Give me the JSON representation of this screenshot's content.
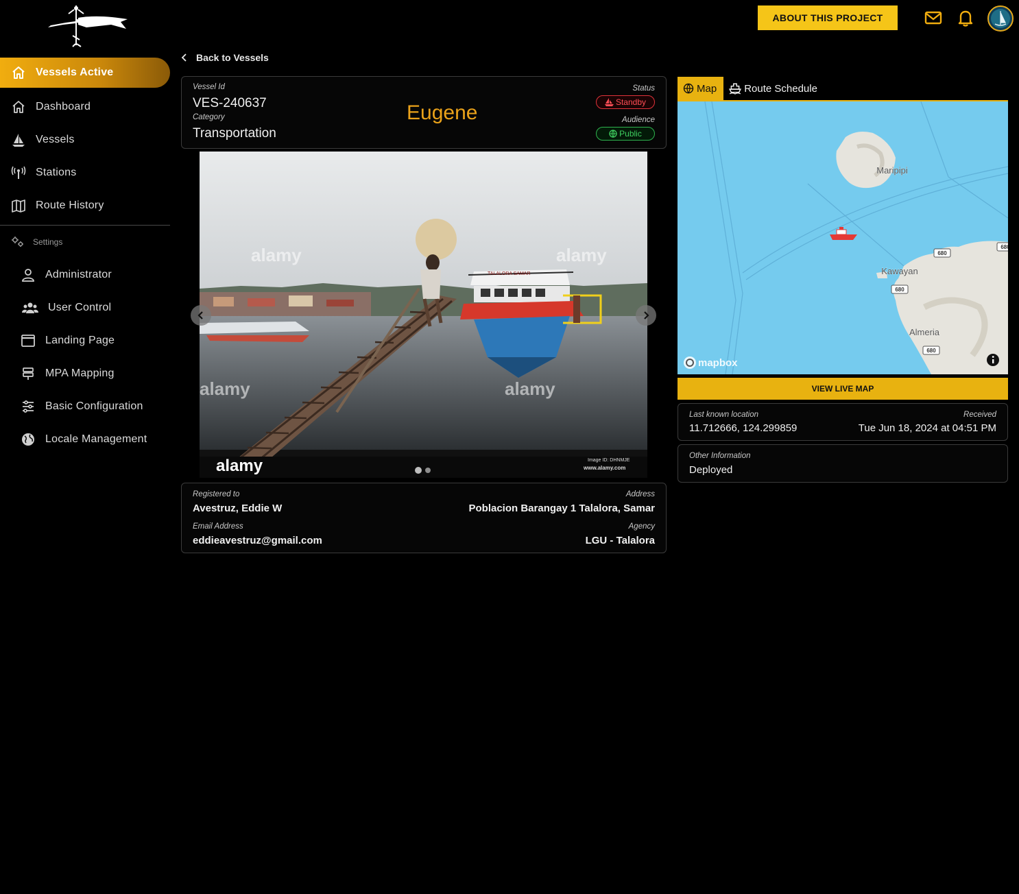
{
  "header": {
    "about_label": "ABOUT THIS PROJECT",
    "icons": [
      "mail-icon",
      "bell-icon",
      "avatar"
    ],
    "accent_color": "#f5c518"
  },
  "sidebar": {
    "items": [
      {
        "label": "Vessels Active",
        "icon": "home-icon",
        "active": true
      },
      {
        "label": "Dashboard",
        "icon": "home-icon"
      },
      {
        "label": "Vessels",
        "icon": "sailboat-icon"
      },
      {
        "label": "Stations",
        "icon": "antenna-icon"
      },
      {
        "label": "Route History",
        "icon": "map-icon"
      }
    ],
    "settings_label": "Settings",
    "settings_items": [
      {
        "label": "Administrator",
        "icon": "user-icon"
      },
      {
        "label": "User Control",
        "icon": "users-icon"
      },
      {
        "label": "Landing Page",
        "icon": "window-icon"
      },
      {
        "label": "MPA Mapping",
        "icon": "signpost-icon"
      },
      {
        "label": "Basic Configuration",
        "icon": "sliders-icon"
      },
      {
        "label": "Locale Management",
        "icon": "globe-icon"
      }
    ]
  },
  "back_label": "Back to Vessels",
  "vessel": {
    "id_label": "Vessel Id",
    "id": "VES-240637",
    "category_label": "Category",
    "category": "Transportation",
    "name": "Eugene",
    "status_label": "Status",
    "status": "Standby",
    "audience_label": "Audience",
    "audience": "Public"
  },
  "photo": {
    "watermark": "alamy",
    "image_id": "Image ID: DHNMJE",
    "site": "www.alamy.com",
    "boat_sign": "TALALORA SAMAR",
    "slides": 2,
    "current_slide": 1
  },
  "owner": {
    "registered_label": "Registered to",
    "registered": "Avestruz, Eddie W",
    "address_label": "Address",
    "address": "Poblacion Barangay 1 Talalora, Samar",
    "email_label": "Email Address",
    "email": "eddieavestruz@gmail.com",
    "agency_label": "Agency",
    "agency": "LGU - Talalora"
  },
  "tabs": [
    {
      "label": "Map",
      "icon": "globe-icon",
      "active": true
    },
    {
      "label": "Route Schedule",
      "icon": "ship-icon"
    }
  ],
  "map": {
    "places": [
      "Maripipi",
      "Kawayan",
      "Almeria"
    ],
    "road_shield": "680",
    "attribution": "mapbox"
  },
  "view_live_label": "VIEW LIVE MAP",
  "location": {
    "label": "Last known location",
    "value": "11.712666, 124.299859",
    "received_label": "Received",
    "received": "Tue Jun 18, 2024 at 04:51 PM"
  },
  "other": {
    "label": "Other Information",
    "value": "Deployed"
  }
}
